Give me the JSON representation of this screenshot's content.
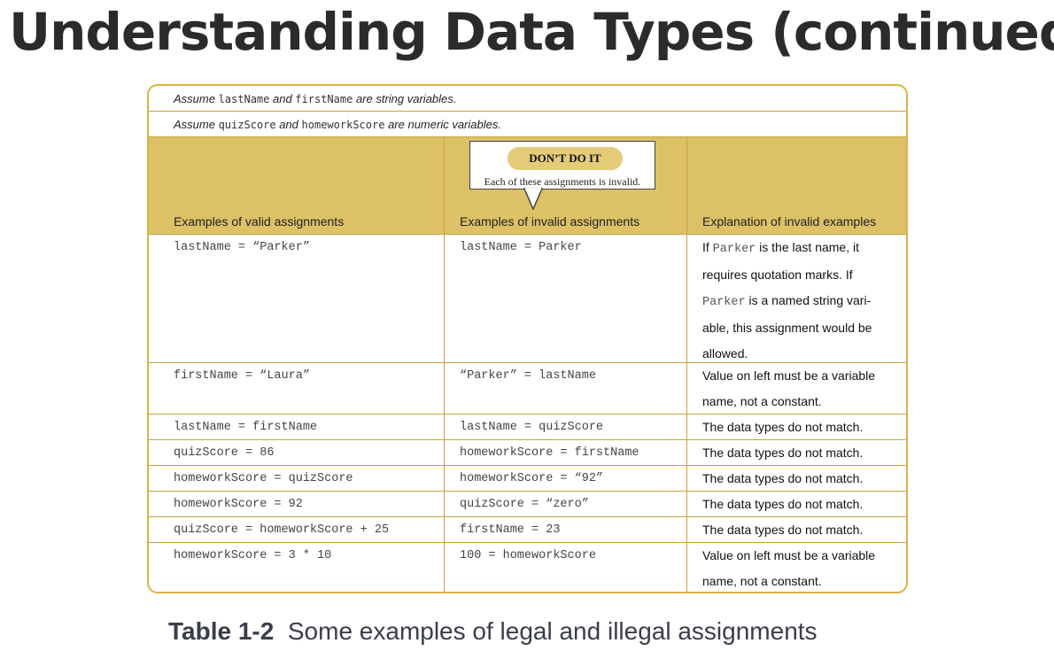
{
  "title": "Understanding Data Types (continued)",
  "notes": [
    {
      "pre": "Assume ",
      "v1": "lastName",
      "mid": " and ",
      "v2": "firstName",
      "post": " are string variables."
    },
    {
      "pre": "Assume ",
      "v1": "quizScore",
      "mid": " and ",
      "v2": "homeworkScore",
      "post": " are numeric variables."
    }
  ],
  "headers": {
    "valid": "Examples of valid assignments",
    "invalid": "Examples of invalid assignments",
    "explanation": "Explanation of invalid examples"
  },
  "callout": {
    "badge": "DON’T DO IT",
    "text": "Each of these assignments is invalid."
  },
  "rows": [
    {
      "valid": "lastName = “Parker”",
      "invalid": "lastName = Parker"
    },
    {
      "valid": "firstName = “Laura”",
      "invalid": "“Parker” = lastName",
      "explanation": "Value on left must be a variable name, not a constant."
    },
    {
      "valid": "lastName = firstName",
      "invalid": "lastName = quizScore",
      "explanation": "The data types do not match."
    },
    {
      "valid": "quizScore = 86",
      "invalid": "homeworkScore = firstName",
      "explanation": "The data types do not match."
    },
    {
      "valid": "homeworkScore = quizScore",
      "invalid": "homeworkScore = “92”",
      "explanation": "The data types do not match."
    },
    {
      "valid": "homeworkScore = 92",
      "invalid": "quizScore = “zero”",
      "explanation": "The data types do not match."
    },
    {
      "valid": "quizScore = homeworkScore + 25",
      "invalid": "firstName = 23",
      "explanation": "The data types do not match."
    },
    {
      "valid": "homeworkScore = 3 * 10",
      "invalid": "100 = homeworkScore",
      "explanation": "Value on left must be a variable name, not a constant."
    }
  ],
  "row0_explanation": {
    "a": "If ",
    "code1": "Parker",
    "b": " is the last name, it requires quotation marks. If ",
    "code2": "Parker",
    "c": " is a named string vari-able, this assignment would be allowed."
  },
  "caption": {
    "label": "Table 1-2",
    "text": "Some examples of legal and illegal assignments"
  }
}
